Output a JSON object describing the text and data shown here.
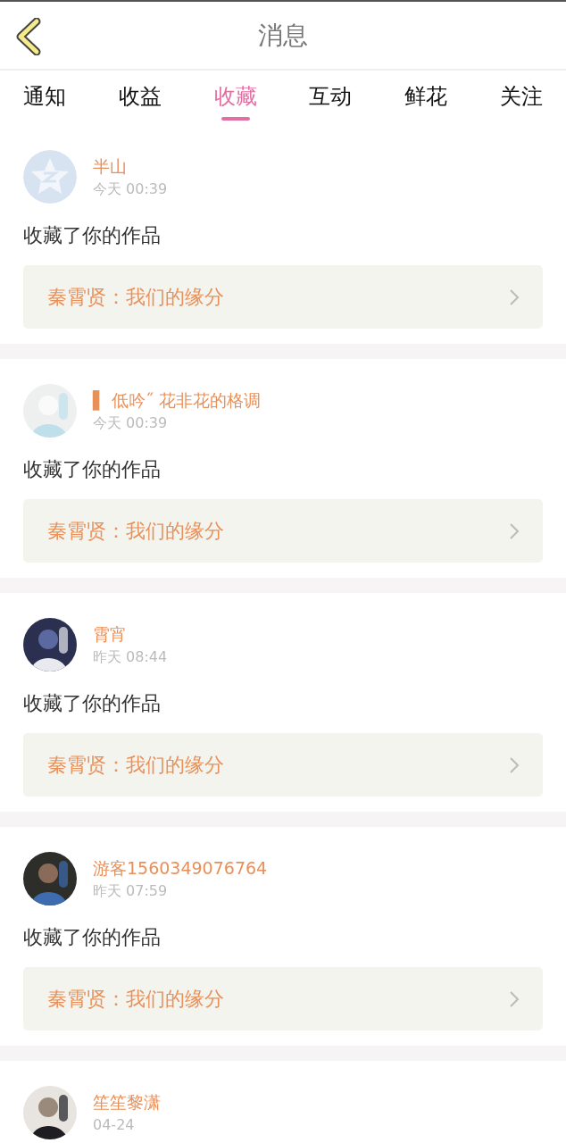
{
  "header": {
    "title": "消息"
  },
  "tabs": [
    {
      "label": "通知",
      "selected": false
    },
    {
      "label": "收益",
      "selected": false
    },
    {
      "label": "收藏",
      "selected": true
    },
    {
      "label": "互动",
      "selected": false
    },
    {
      "label": "鲜花",
      "selected": false
    },
    {
      "label": "关注",
      "selected": false
    }
  ],
  "messages": [
    {
      "avatar": {
        "kind": "default"
      },
      "name": "半山",
      "time": "今天 00:39",
      "text": "收藏了你的作品",
      "work": "秦霄贤：我们的缘分"
    },
    {
      "name": "▌ 低吟˝ 花非花的格调",
      "time": "今天 00:39",
      "text": "收藏了你的作品",
      "work": "秦霄贤：我们的缘分"
    },
    {
      "name": "霄宵",
      "time": "昨天 08:44",
      "text": "收藏了你的作品",
      "work": "秦霄贤：我们的缘分"
    },
    {
      "name": "游客1560349076764",
      "time": "昨天 07:59",
      "text": "收藏了你的作品",
      "work": "秦霄贤：我们的缘分"
    },
    {
      "name": "笙笙黎潇",
      "time": "04-24"
    }
  ]
}
